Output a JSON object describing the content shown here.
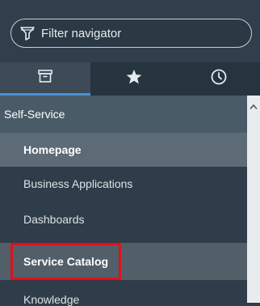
{
  "filter": {
    "placeholder": "Filter navigator",
    "icon": "filter-icon"
  },
  "tabs": [
    {
      "name": "all-applications",
      "icon": "archive-box-icon",
      "active": true
    },
    {
      "name": "favorites",
      "icon": "star-icon",
      "active": false
    },
    {
      "name": "history",
      "icon": "clock-icon",
      "active": false
    }
  ],
  "nav": {
    "section": "Self-Service",
    "items": [
      {
        "label": "Homepage"
      },
      {
        "label": "Business Applications"
      },
      {
        "label": "Dashboards"
      },
      {
        "label": "Service Catalog"
      },
      {
        "label": "Knowledge"
      }
    ]
  },
  "colors": {
    "accent": "#4a90d9",
    "highlight": "#e0101c"
  }
}
